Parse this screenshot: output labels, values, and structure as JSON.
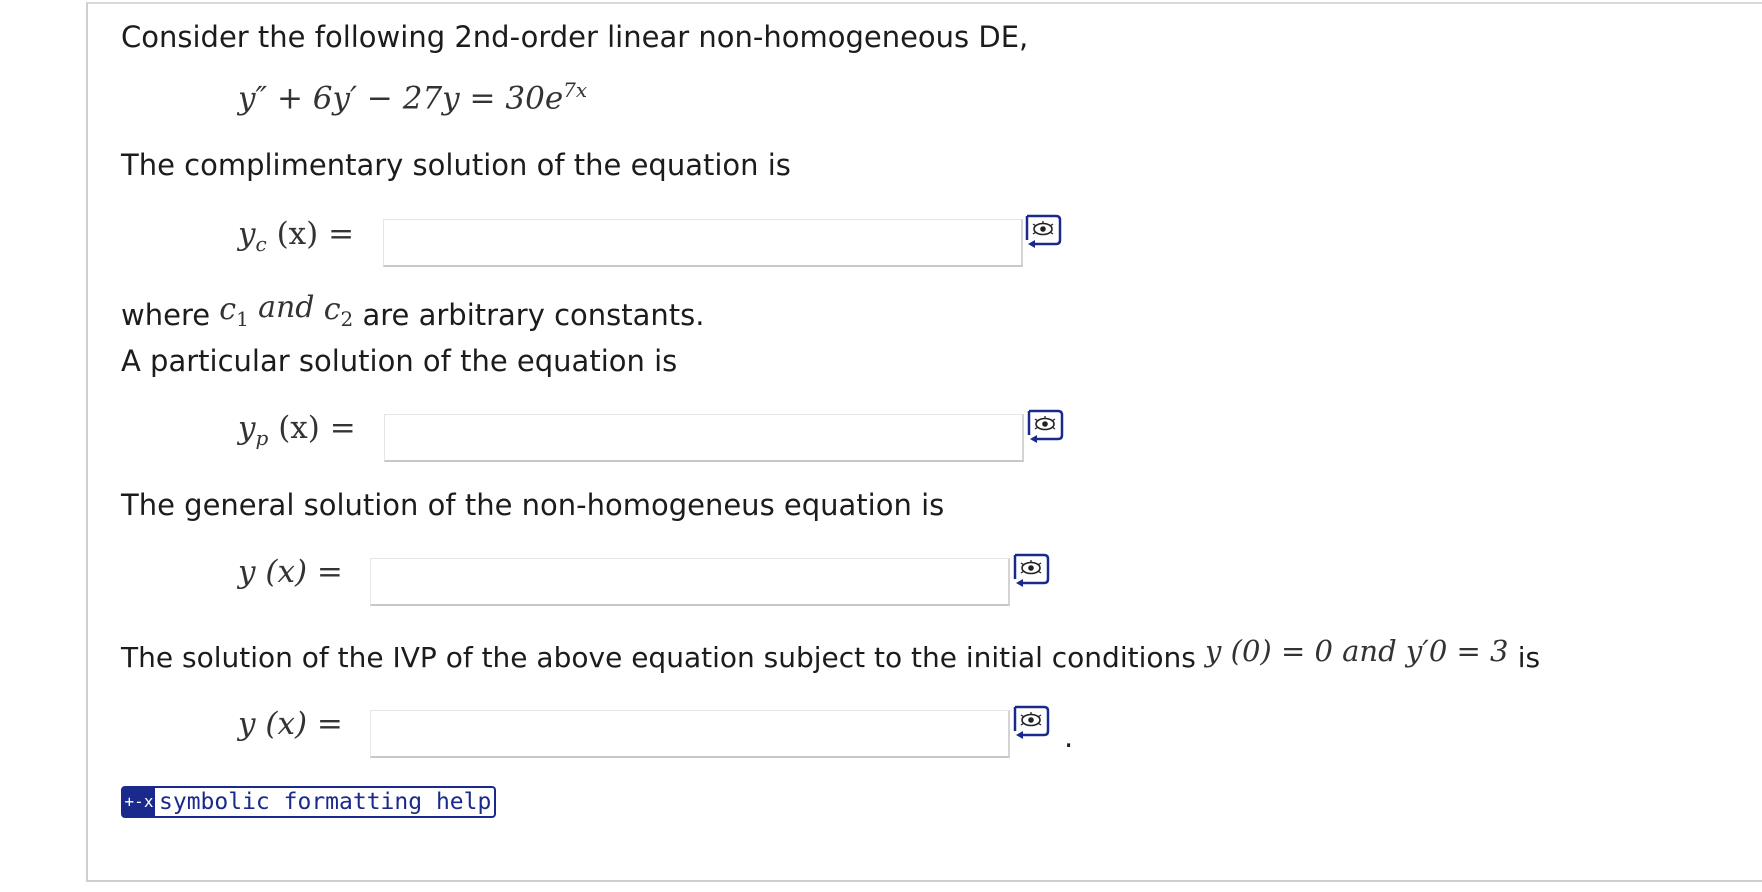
{
  "intro": "Consider the following 2nd-order linear non-homogeneous DE,",
  "equation": {
    "lhs": "y″ + 6y′ − 27y = 30e",
    "exp": "7x"
  },
  "comp": {
    "text": "The complimentary solution of the equation is",
    "label_main": "y",
    "label_sub": "c",
    "label_arg": "(x) ="
  },
  "where": {
    "prefix": "where",
    "c1": "c",
    "c1_sub": "1",
    "and": "and",
    "c2": "c",
    "c2_sub": "2",
    "suffix": "are arbitrary constants."
  },
  "part": {
    "text": "A particular solution of the equation is",
    "label_main": "y",
    "label_sub": "p",
    "label_arg": "(x) ="
  },
  "general": {
    "text": "The general solution of the non-homogeneus equation is",
    "label": "y (x) ="
  },
  "ivp": {
    "text": "The solution of the IVP of the above equation subject to the initial conditions",
    "cond": "y (0) = 0 and y′0 = 3",
    "suffix": "is",
    "label": "y (x) =",
    "period": "."
  },
  "help": {
    "icon": "+-x",
    "label": "symbolic formatting help"
  },
  "inputs": {
    "yc": "",
    "yp": "",
    "y_general": "",
    "y_ivp": ""
  },
  "colors": {
    "accent": "#1a2a8c"
  }
}
